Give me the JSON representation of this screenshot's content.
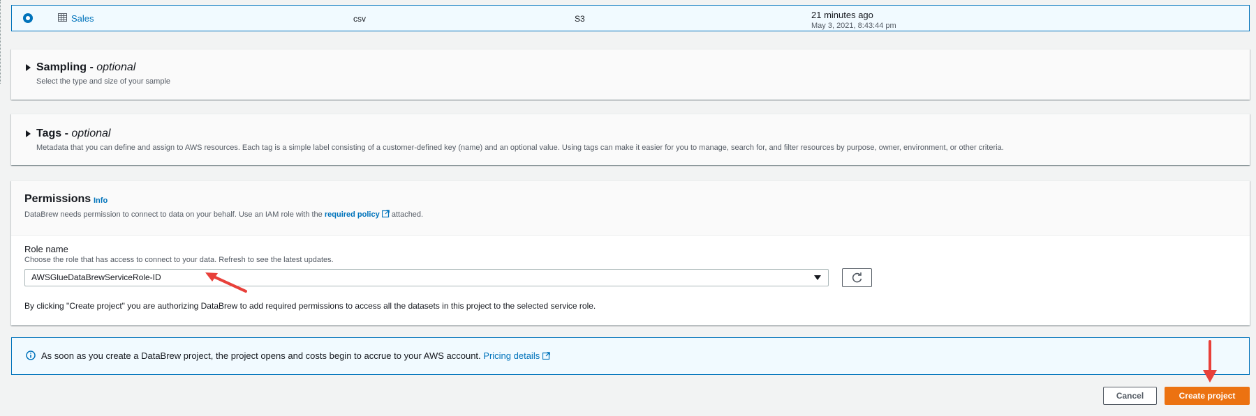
{
  "dataset_row": {
    "name": "Sales",
    "format": "csv",
    "source": "S3",
    "modified_relative": "21 minutes ago",
    "modified_date": "May 3, 2021, 8:43:44 pm",
    "selected": true
  },
  "sampling": {
    "title": "Sampling",
    "optional_label": "optional",
    "separator": "-",
    "description": "Select the type and size of your sample"
  },
  "tags": {
    "title": "Tags",
    "optional_label": "optional",
    "separator": "-",
    "description": "Metadata that you can define and assign to AWS resources. Each tag is a simple label consisting of a customer-defined key (name) and an optional value. Using tags can make it easier for you to manage, search for, and filter resources by purpose, owner, environment, or other criteria."
  },
  "permissions": {
    "title": "Permissions",
    "info_label": "Info",
    "description_prefix": "DataBrew needs permission to connect to data on your behalf. Use an IAM role with the",
    "policy_link": "required policy",
    "description_suffix": "attached.",
    "role_label": "Role name",
    "role_hint": "Choose the role that has access to connect to your data. Refresh to see the latest updates.",
    "role_value": "AWSGlueDataBrewServiceRole-ID",
    "authorize_note": "By clicking \"Create project\" you are authorizing DataBrew to add required permissions to access all the datasets in this project to the selected service role."
  },
  "alert": {
    "text": "As soon as you create a DataBrew project, the project opens and costs begin to accrue to your AWS account.",
    "link": "Pricing details"
  },
  "footer": {
    "cancel_label": "Cancel",
    "create_label": "Create project"
  },
  "colors": {
    "link_blue": "#0073bb",
    "primary_orange": "#ec7211",
    "annotation_red": "#e8403a"
  }
}
